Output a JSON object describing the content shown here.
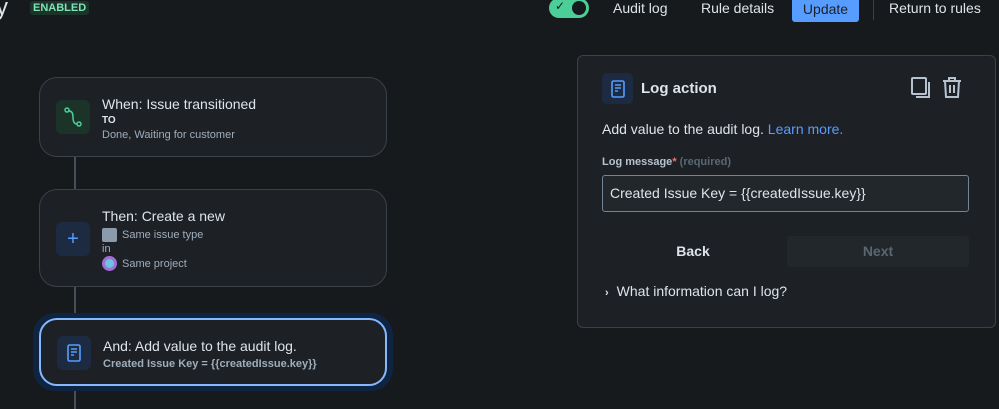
{
  "header": {
    "title": "y",
    "status_badge": "ENABLED",
    "toggle_on": true,
    "audit_log": "Audit log",
    "rule_details": "Rule details",
    "update": "Update",
    "return": "Return to rules"
  },
  "flow": [
    {
      "title": "When: Issue transitioned",
      "label": "TO",
      "detail": "Done, Waiting for customer"
    },
    {
      "title": "Then: Create a new",
      "issue_type": "Same issue type",
      "in": "in",
      "project": "Same project"
    },
    {
      "title": "And: Add value to the audit log.",
      "detail": "Created Issue Key = {{createdIssue.key}}"
    }
  ],
  "panel": {
    "title": "Log action",
    "description": "Add value to the audit log.",
    "learn_more": "Learn more.",
    "field_label": "Log message",
    "required_mark": "*",
    "required_hint": "(required)",
    "field_value": "Created Issue Key = {{createdIssue.key}}",
    "back": "Back",
    "next": "Next",
    "expander": "What information can I log?"
  },
  "colors": {
    "accent": "#579dff",
    "success": "#4bce97"
  }
}
